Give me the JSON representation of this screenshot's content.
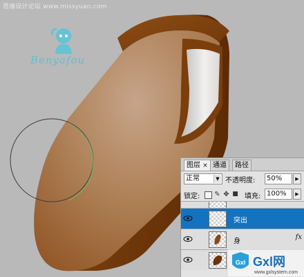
{
  "watermark": {
    "top_text": "思缘设计论坛 www.missyuan.com",
    "signature": "Benyafou"
  },
  "layers_panel": {
    "tabs": [
      "图层",
      "通道",
      "路径"
    ],
    "close_glyph": "×",
    "blend_mode": "正常",
    "opacity_label": "不透明度:",
    "opacity_value": "50%",
    "lock_label": "锁定:",
    "fill_label": "填充:",
    "fill_value": "100%",
    "layers": [
      {
        "name": "",
        "visible": true,
        "active": false
      },
      {
        "name": "突出",
        "visible": true,
        "active": true
      },
      {
        "name": "身",
        "visible": true,
        "active": false,
        "has_fx": true,
        "fx_label": "fx"
      },
      {
        "name": "",
        "visible": true,
        "active": false
      }
    ]
  },
  "site_logo": {
    "text": "Gxl网",
    "url": "www.gxlsystem.com"
  }
}
